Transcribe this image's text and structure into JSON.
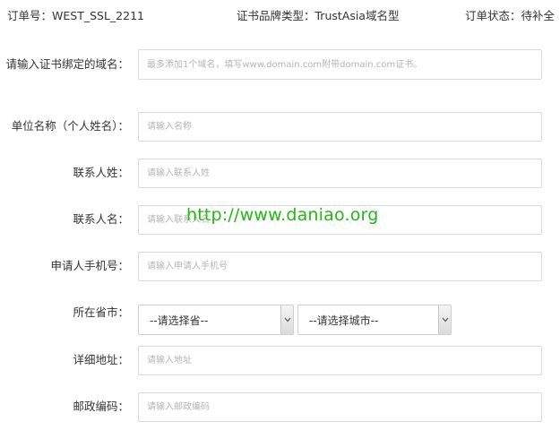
{
  "header": {
    "order_no": "订单号：WEST_SSL_2211",
    "brand_type": "证书品牌类型：TrustAsia域名型",
    "order_status": "订单状态：待补全"
  },
  "form": {
    "domain": {
      "label": "请输入证书绑定的域名：",
      "placeholder": "最多添加1个域名，填写www.domain.com附带domain.com证书。"
    },
    "company": {
      "label": "单位名称（个人姓名）：",
      "placeholder": "请输入名称"
    },
    "surname": {
      "label": "联系人姓：",
      "placeholder": "请输入联系人姓"
    },
    "given_name": {
      "label": "联系人名：",
      "placeholder": "请输入联系人名"
    },
    "mobile": {
      "label": "申请人手机号：",
      "placeholder": "请输入申请人手机号"
    },
    "region": {
      "label": "所在省市：",
      "province_selected": "--请选择省--",
      "city_selected": "--请选择城市--"
    },
    "address": {
      "label": "详细地址：",
      "placeholder": "请输入地址"
    },
    "postcode": {
      "label": "邮政编码：",
      "placeholder": "请输入邮政编码"
    }
  },
  "watermark": "http://www.daniao.org",
  "colors": {
    "watermark": "#23b815",
    "input_border": "#d9d9d9",
    "placeholder": "#b5b5b5"
  }
}
